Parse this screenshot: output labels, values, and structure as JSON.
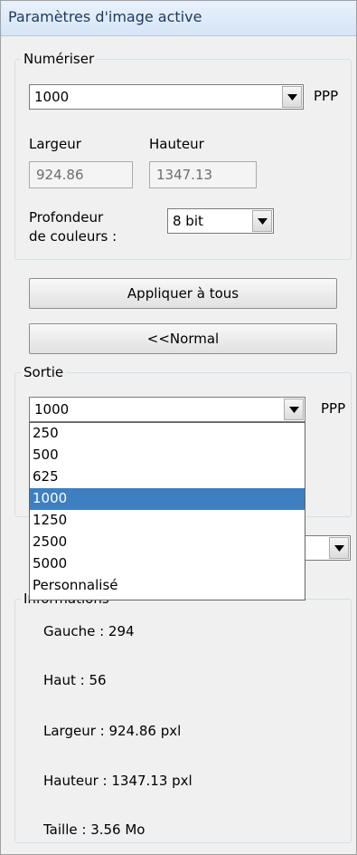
{
  "panel_title": "Paramètres d'image active",
  "scan": {
    "legend": "Numériser",
    "resolution_value": "1000",
    "resolution_unit": "PPP",
    "width_label": "Largeur",
    "height_label": "Hauteur",
    "width_value": "924.86",
    "height_value": "1347.13",
    "depth_label_line1": "Profondeur",
    "depth_label_line2": "de couleurs :",
    "depth_value": "8 bit"
  },
  "apply_all_label": "Appliquer à tous",
  "normal_label": "<<Normal",
  "output": {
    "legend": "Sortie",
    "resolution_value": "1000",
    "resolution_unit": "PPP",
    "options": [
      "250",
      "500",
      "625",
      "1000",
      "1250",
      "2500",
      "5000",
      "Personnalisé"
    ],
    "selected_index": 3
  },
  "info": {
    "legend": "Informations",
    "left": "Gauche : 294",
    "top": "Haut : 56",
    "width": "Largeur : 924.86 pxl",
    "height": "Hauteur : 1347.13 pxl",
    "size": "Taille : 3.56 Mo"
  }
}
